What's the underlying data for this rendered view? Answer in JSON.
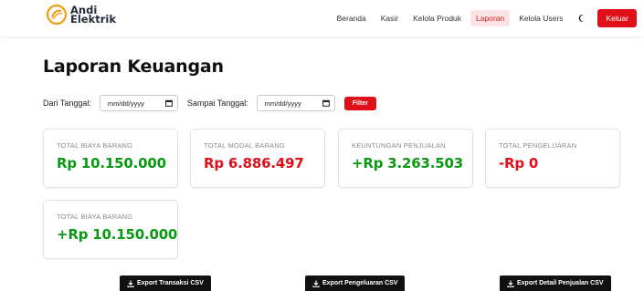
{
  "brand": {
    "line1": "Andi",
    "line2": "Elektrik"
  },
  "nav": {
    "items": [
      {
        "label": "Beranda"
      },
      {
        "label": "Kasir"
      },
      {
        "label": "Kelola Produk"
      },
      {
        "label": "Laporan",
        "active": true
      },
      {
        "label": "Kelola Users"
      }
    ],
    "theme_icon": "moon-icon",
    "logout_label": "Keluar"
  },
  "page": {
    "title": "Laporan Keuangan"
  },
  "filter": {
    "start_label": "Dari Tanggal:",
    "start_placeholder": "mm/dd/yyyy",
    "end_label": "Sampai Tanggal:",
    "end_placeholder": "mm/dd/yyyy",
    "button_label": "Filter"
  },
  "cards": [
    {
      "label": "TOTAL BIAYA BARANG",
      "value": "Rp 10.150.000",
      "color": "#0a9a12"
    },
    {
      "label": "TOTAL MODAL BARANG",
      "value": "Rp 6.886.497",
      "color": "#e0101a"
    },
    {
      "label": "KEUNTUNGAN PENJUALAN",
      "value": "+Rp 3.263.503",
      "color": "#0a9a12"
    },
    {
      "label": "TOTAL PENGELUARAN",
      "value": "-Rp 0",
      "color": "#e0101a"
    },
    {
      "label": "TOTAL BIAYA BARANG",
      "value": "+Rp 10.150.000",
      "color": "#0a9a12"
    }
  ],
  "exports": [
    {
      "label": "Export Transaksi CSV"
    },
    {
      "label": "Export Pengeluaran CSV"
    },
    {
      "label": "Export Detail Penjualan CSV"
    }
  ],
  "colors": {
    "accent": "#e0101a",
    "positive": "#0a9a12",
    "brand_orange": "#f39c12"
  }
}
